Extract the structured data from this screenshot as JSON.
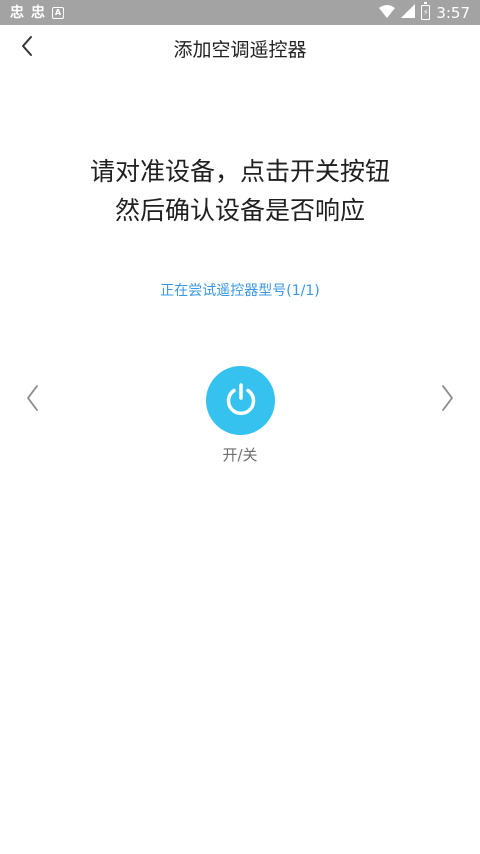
{
  "status_bar": {
    "left_icons": [
      "忠",
      "忠"
    ],
    "a_icon_letter": "A",
    "time": "3:57"
  },
  "nav": {
    "title": "添加空调遥控器",
    "back_icon": "chevron-left-icon"
  },
  "instruction": {
    "line1": "请对准设备，点击开关按钮",
    "line2": "然后确认设备是否响应"
  },
  "trying_model": "正在尝试遥控器型号(1/1)",
  "power": {
    "label": "开/关",
    "icon": "power-icon",
    "color": "#35c2ee"
  },
  "colors": {
    "status_bar_bg": "#a3a3a3",
    "accent_text": "#3a98e4"
  }
}
